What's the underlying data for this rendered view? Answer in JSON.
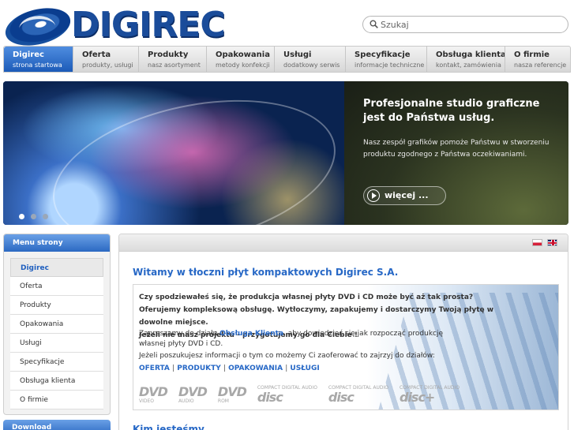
{
  "brand": {
    "name": "DIGIREC"
  },
  "search": {
    "placeholder": "Szukaj"
  },
  "nav": [
    {
      "title": "Digirec",
      "sub": "strona startowa"
    },
    {
      "title": "Oferta",
      "sub": "produkty, usługi"
    },
    {
      "title": "Produkty",
      "sub": "nasz asortyment"
    },
    {
      "title": "Opakowania",
      "sub": "metody konfekcji"
    },
    {
      "title": "Usługi",
      "sub": "dodatkowy serwis"
    },
    {
      "title": "Specyfikacje",
      "sub": "informacje techniczne"
    },
    {
      "title": "Obsługa klienta",
      "sub": "kontakt, zamówienia"
    },
    {
      "title": "O firmie",
      "sub": "nasza referencje"
    }
  ],
  "hero": {
    "title": "Profesjonalne studio graficzne jest do Państwa usług.",
    "text": "Nasz zespół grafików pomoże Państwu w stworzeniu produktu zgodnego z Państwa oczekiwaniami.",
    "button": "więcej ...",
    "slides": 3,
    "active_slide": 1
  },
  "sidebar": {
    "title": "Menu strony",
    "items": [
      "Digirec",
      "Oferta",
      "Produkty",
      "Opakowania",
      "Usługi",
      "Specyfikacje",
      "Obsługa klienta",
      "O firmie"
    ],
    "download": "Download"
  },
  "main": {
    "welcome": "Witamy w tłoczni płyt kompaktowych Digirec S.A.",
    "line1": "Czy spodziewałeś się, że produkcja własnej płyty DVD i CD może być aż tak prosta?",
    "line2": "Oferujemy kompleksową obsługę. Wytłoczymy, zapakujemy i dostarczymy Twoją płytę w dowolne miejsce.",
    "line3": "Jeżeli nie masz projektu - przygotujemy go dla Ciebie !",
    "contact_pre": "Zapraszamy do działu ",
    "contact_link": "Obsługa Klienta",
    "contact_post": ", aby dowiedzieć się jak rozpocząć produkcję własnej płyty DVD i CD.",
    "depts_text": "Jeżeli poszukujesz informacji o tym co możemy Ci zaoferować to zajrzyj do działów:",
    "dept_links": [
      "OFERTA",
      "PRODUKTY",
      "OPAKOWANIA",
      "USŁUGI"
    ],
    "formats": [
      {
        "big": "DVD",
        "sm": "VIDEO"
      },
      {
        "big": "DVD",
        "sm": "AUDIO"
      },
      {
        "big": "DVD",
        "sm": "ROM"
      },
      {
        "big": "disc",
        "sm": "COMPACT DIGITAL AUDIO"
      },
      {
        "big": "disc",
        "sm": "COMPACT DIGITAL AUDIO"
      },
      {
        "big": "disc+",
        "sm": "COMPACT DIGITAL AUDIO"
      }
    ],
    "section2": "Kim jesteśmy"
  }
}
